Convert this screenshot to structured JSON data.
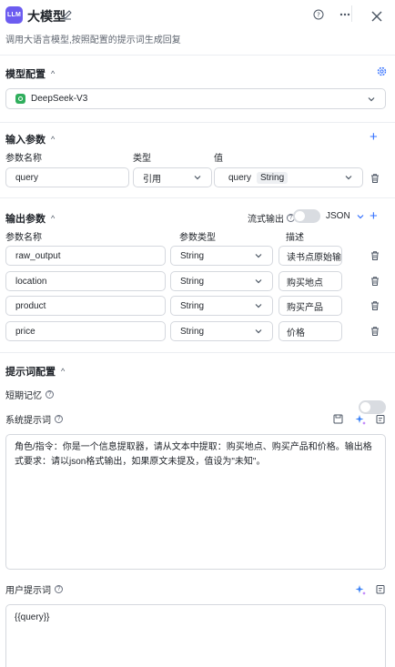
{
  "header": {
    "logo_text": "LLM",
    "title": "大模型",
    "description": "调用大语言模型,按照配置的提示词生成回复"
  },
  "model_config": {
    "title": "模型配置",
    "model_name": "DeepSeek-V3"
  },
  "input_params": {
    "title": "输入参数",
    "col_name": "参数名称",
    "col_type": "类型",
    "col_value": "值",
    "row": {
      "name": "query",
      "type": "引用",
      "value_ref": "query",
      "value_type": "String"
    }
  },
  "output_params": {
    "title": "输出参数",
    "stream_label": "流式输出",
    "format": "JSON",
    "col_name": "参数名称",
    "col_type": "参数类型",
    "col_desc": "描述",
    "rows": [
      {
        "name": "raw_output",
        "type": "String",
        "desc": "读书点原始输出"
      },
      {
        "name": "location",
        "type": "String",
        "desc": "购买地点"
      },
      {
        "name": "product",
        "type": "String",
        "desc": "购买产品"
      },
      {
        "name": "price",
        "type": "String",
        "desc": "价格"
      }
    ]
  },
  "prompt_config": {
    "title": "提示词配置",
    "short_memory_label": "短期记忆",
    "system_prompt_label": "系统提示词",
    "system_prompt_text": "角色/指令：你是一个信息提取器，请从文本中提取：购买地点、购买产品和价格。输出格式要求：请以json格式输出，如果原文未提及，值设为\"未知\"。",
    "user_prompt_label": "用户提示词",
    "user_prompt_text": "{{query}}"
  },
  "colors": {
    "accent": "#3370ff",
    "logo": "#6c5cf0",
    "model_badge": "#2fae5c"
  }
}
